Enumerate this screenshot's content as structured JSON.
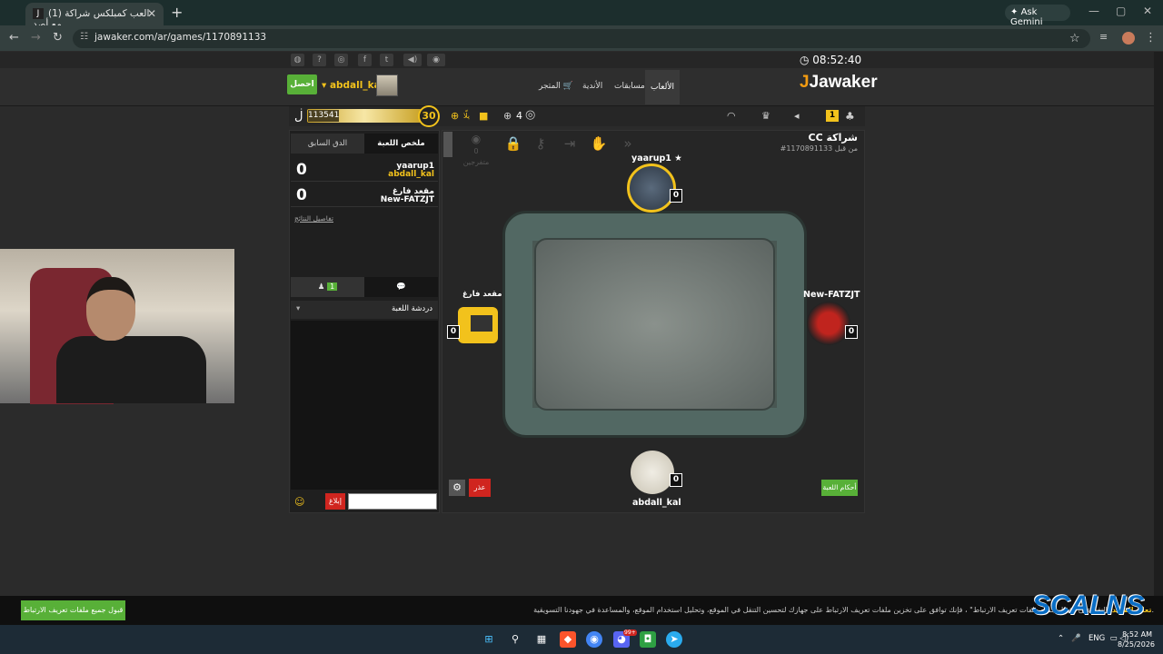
{
  "browser": {
    "tab_title": "(1) العب كمبلكس شراكة مع أصد",
    "tab_icon": "J",
    "new_tab": "+",
    "gemini_label": "Ask Gemini",
    "url": "jawaker.com/ar/games/1170891133"
  },
  "site": {
    "clock": "08:52:40",
    "login_button": "احصل",
    "username": "abdall_kal",
    "nav": [
      "الألعاب",
      "مسابقات",
      "الأندية",
      "المتجر"
    ],
    "logo": "Jawaker"
  },
  "gamebar": {
    "coins": "113541",
    "level": "30",
    "weekly_label": "يلّا",
    "players_count": "4",
    "notifications": "1"
  },
  "left_panel": {
    "tab_summary": "ملخص اللعبة",
    "tab_previous": "الدق السابق",
    "scores": [
      {
        "score": "0",
        "name1": "yaarup1",
        "name2": "abdall_kal"
      },
      {
        "score": "0",
        "name1": "مقعد فارغ",
        "name2": "New-FATZJT"
      }
    ],
    "details_link": "تفاصيل النتائج",
    "chat_online": "1",
    "chat_label": "دردشة اللعبة",
    "report_button": "إبلاغ"
  },
  "table": {
    "spectators": "0 متفرجين",
    "title": "CC شراكة",
    "game_id": "#1170891133 من قبل",
    "players": {
      "top": {
        "name": "yaarup1",
        "score": "0"
      },
      "right": {
        "name": "New-FATZJT",
        "score": "0"
      },
      "left": {
        "name": "مقعد فارغ",
        "score": "0"
      },
      "bottom": {
        "name": "abdall_kal",
        "score": "0"
      }
    },
    "excuse_button": "عذر",
    "rules_button": "أحكام اللعبة"
  },
  "cookie": {
    "accept_button": "قبول جميع ملفات تعريف الارتباط",
    "text": "بالنقر على \"قبول جميع ملفات تعريف الارتباط\" ، فإنك توافق على تخزين ملفات تعريف الارتباط على جهازك لتحسين التنقل في الموقع، وتحليل استخدام الموقع، والمساعدة في جهودنا التسويقية.",
    "more_link": "تعلم المزيد"
  },
  "watermark": "SCALNS",
  "taskbar": {
    "lang": "ENG",
    "time": "8:52 AM",
    "date": "8/25/2026",
    "badge": "99+"
  },
  "colors": {
    "accent": "#f2c21c",
    "green": "#58b038",
    "red": "#d0251f"
  }
}
